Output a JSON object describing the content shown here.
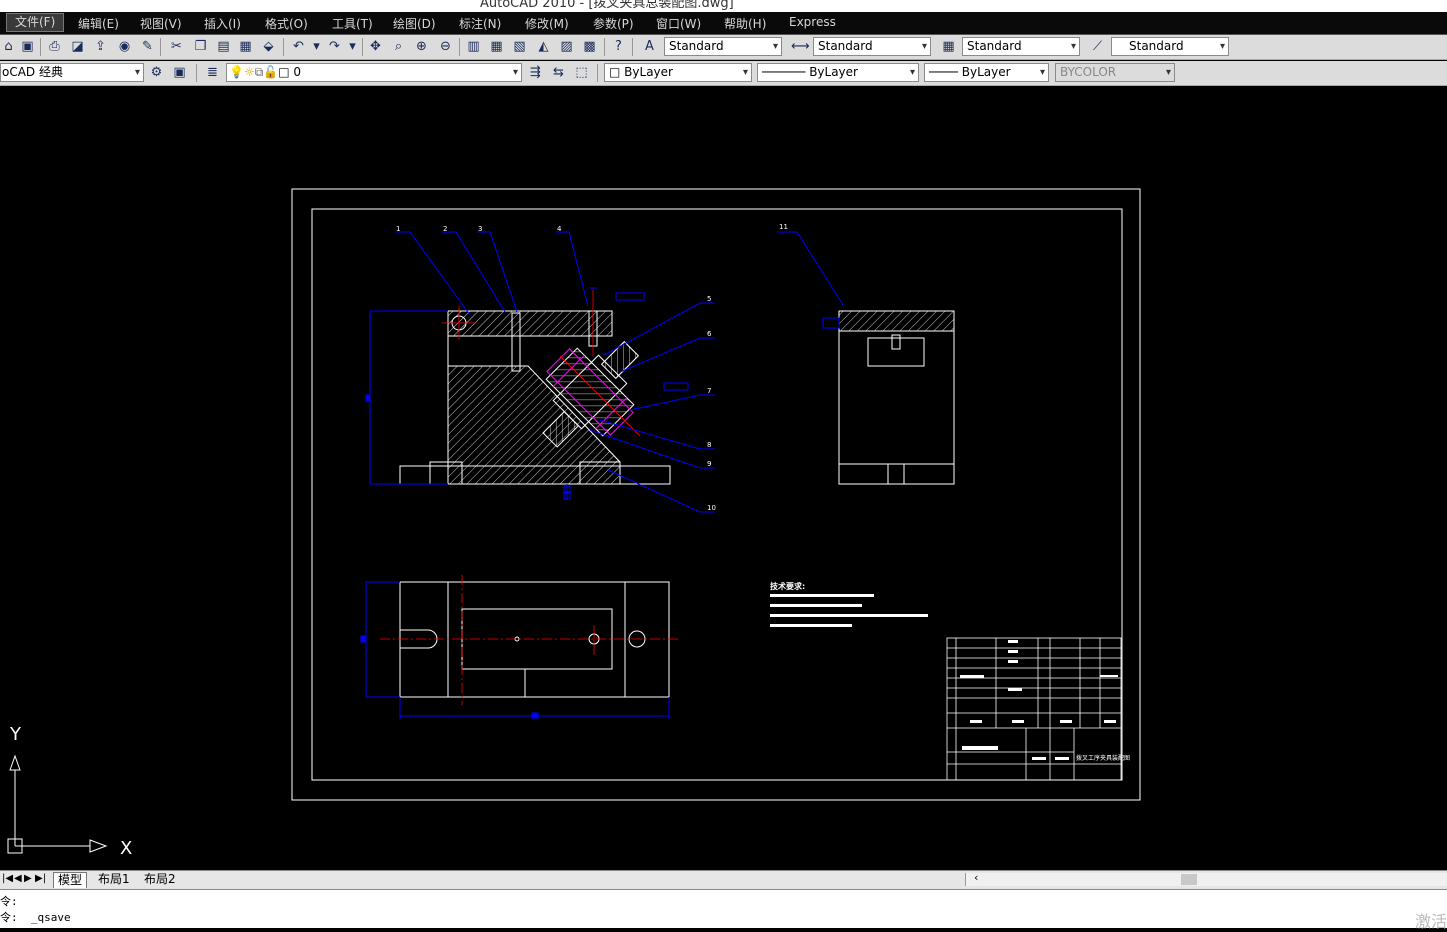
{
  "window": {
    "title": "AutoCAD 2010 - [拨叉夹具总装配图.dwg]"
  },
  "menu": [
    "文件(F)",
    "编辑(E)",
    "视图(V)",
    "插入(I)",
    "格式(O)",
    "工具(T)",
    "绘图(D)",
    "标注(N)",
    "修改(M)",
    "参数(P)",
    "窗口(W)",
    "帮助(H)",
    "Express"
  ],
  "toolbar": {
    "text_style": "Standard",
    "dim_style": "Standard",
    "table_style": "Standard",
    "mleader_style": "Standard"
  },
  "properties": {
    "workspace": "oCAD 经典",
    "layer": "0",
    "color": "ByLayer",
    "linetype": "ByLayer",
    "lineweight": "ByLayer",
    "plotstyle": "BYCOLOR"
  },
  "drawing": {
    "balloons": [
      "1",
      "2",
      "3",
      "4",
      "5",
      "6",
      "7",
      "8",
      "9",
      "10",
      "11"
    ],
    "tech_req_title": "技术要求:",
    "title_block_name": "拨叉工序夹具装配图"
  },
  "ucs": {
    "y_label": "Y",
    "x_label": "X"
  },
  "tabs": [
    "模型",
    "布局1",
    "布局2"
  ],
  "command": {
    "line1": "令:",
    "line2": "令:  _qsave"
  },
  "watermark": "激活",
  "colors": {
    "canvas": "#000000",
    "border": "#ffffff",
    "leader": "#0000ff",
    "center": "#ff0000",
    "part": "#ff00ff"
  }
}
